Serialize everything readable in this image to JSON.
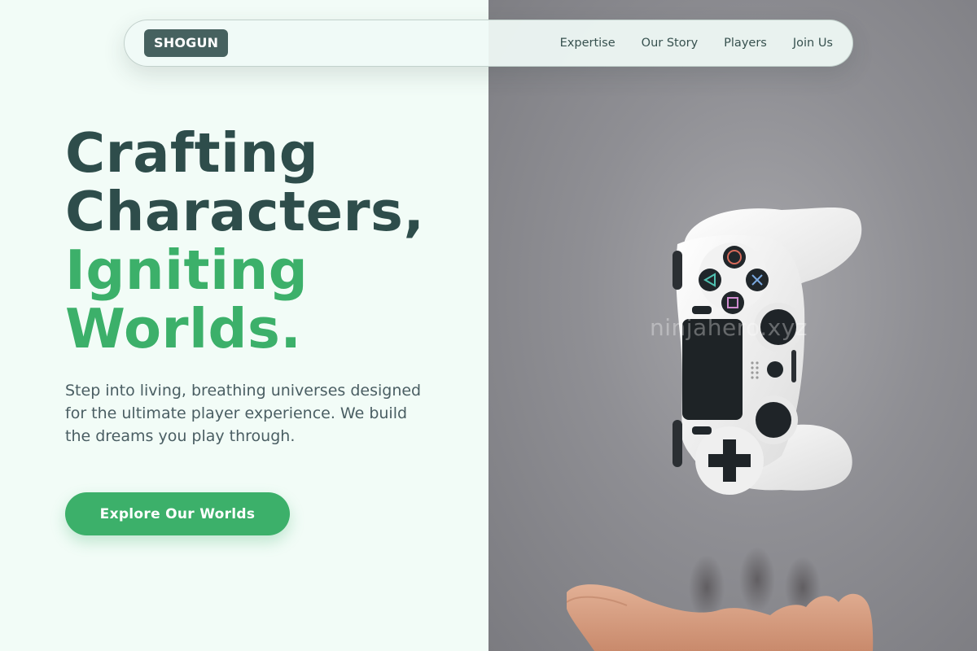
{
  "nav": {
    "logo": "SHOGUN",
    "links": [
      "Expertise",
      "Our Story",
      "Players",
      "Join Us"
    ]
  },
  "hero": {
    "headline_line1": "Crafting",
    "headline_line2": "Characters,",
    "headline_line3": "Igniting",
    "headline_line4": "Worlds.",
    "subtext": "Step into living, breathing universes designed for the ultimate player experience. We build the dreams you play through.",
    "cta_label": "Explore Our Worlds"
  },
  "image": {
    "watermark": "ninjahero.xyz",
    "subject": "gamepad-controller-floating-above-hand"
  },
  "colors": {
    "dark_green": "#2e4d4b",
    "accent_green": "#3cb06a",
    "logo_bg": "#46615f",
    "page_bg": "#f2fcf7"
  }
}
